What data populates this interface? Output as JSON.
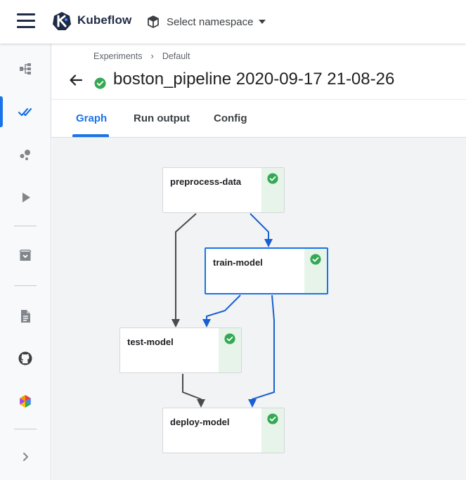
{
  "header": {
    "brand": "Kubeflow",
    "namespace_label": "Select namespace"
  },
  "breadcrumbs": [
    "Experiments",
    "Default"
  ],
  "breadcrumb_separator": "›",
  "run": {
    "title": "boston_pipeline 2020-09-17 21-08-26",
    "status": "succeeded"
  },
  "tabs": [
    {
      "label": "Graph",
      "active": true
    },
    {
      "label": "Run output",
      "active": false
    },
    {
      "label": "Config",
      "active": false
    }
  ],
  "sidebar": {
    "items": [
      {
        "icon": "pipelines-icon"
      },
      {
        "icon": "experiments-icon",
        "active": true
      },
      {
        "icon": "artifacts-icon"
      },
      {
        "icon": "executions-icon"
      },
      {
        "icon": "archive-icon"
      },
      {
        "icon": "documentation-icon"
      },
      {
        "icon": "github-icon"
      },
      {
        "icon": "ai-hub-icon"
      },
      {
        "icon": "expand-chevron-icon"
      }
    ]
  },
  "graph": {
    "nodes": [
      {
        "id": "preprocess",
        "label": "preprocess-data",
        "status": "succeeded"
      },
      {
        "id": "train",
        "label": "train-model",
        "status": "succeeded",
        "selected": true
      },
      {
        "id": "test",
        "label": "test-model",
        "status": "succeeded"
      },
      {
        "id": "deploy",
        "label": "deploy-model",
        "status": "succeeded"
      }
    ],
    "edges": [
      {
        "from": "preprocess",
        "to": "test",
        "highlighted": false
      },
      {
        "from": "preprocess",
        "to": "train",
        "highlighted": true
      },
      {
        "from": "train",
        "to": "test",
        "highlighted": true
      },
      {
        "from": "train",
        "to": "deploy",
        "highlighted": true
      },
      {
        "from": "test",
        "to": "deploy",
        "highlighted": false
      }
    ]
  },
  "colors": {
    "accent": "#1a73e8",
    "success": "#34a853",
    "success_bg": "#e6f4ea",
    "edge_default": "#4a4a4a",
    "edge_highlight": "#1a5fd0"
  }
}
